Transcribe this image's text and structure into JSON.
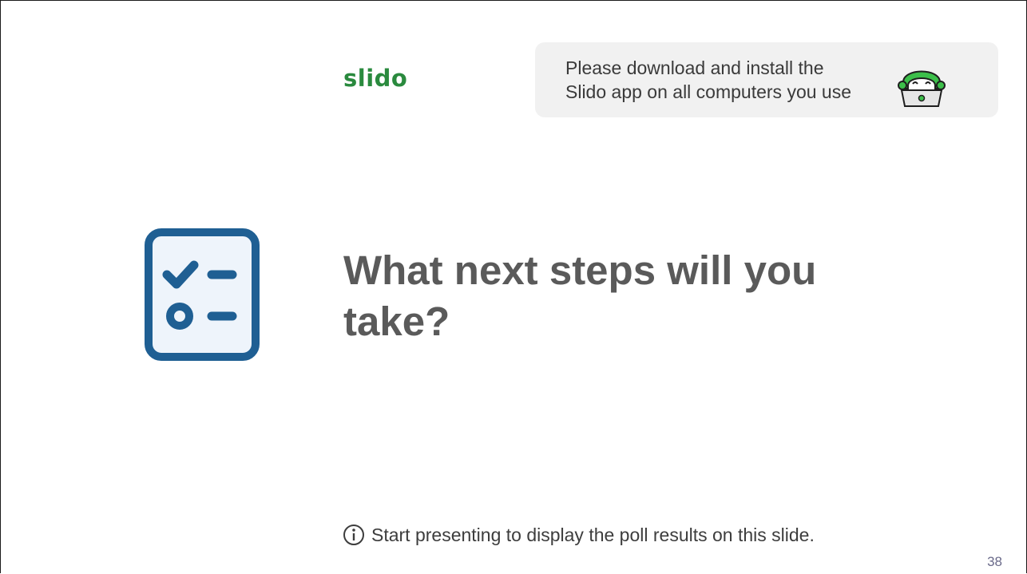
{
  "brand": {
    "name": "slido"
  },
  "banner": {
    "line1": "Please download and install the",
    "line2": "Slido app on all computers you use"
  },
  "question": {
    "line1": "What next steps will you",
    "line2": "take?"
  },
  "hint": {
    "text": "Start presenting to display the poll results on this slide."
  },
  "page": {
    "number": "38"
  },
  "icons": {
    "poll": "checklist-icon",
    "info": "info-icon",
    "mascot": "mascot-icon"
  },
  "colors": {
    "brand": "#2a8a3e",
    "icon_blue": "#1f5f93",
    "banner_bg": "#f1f1f1"
  }
}
